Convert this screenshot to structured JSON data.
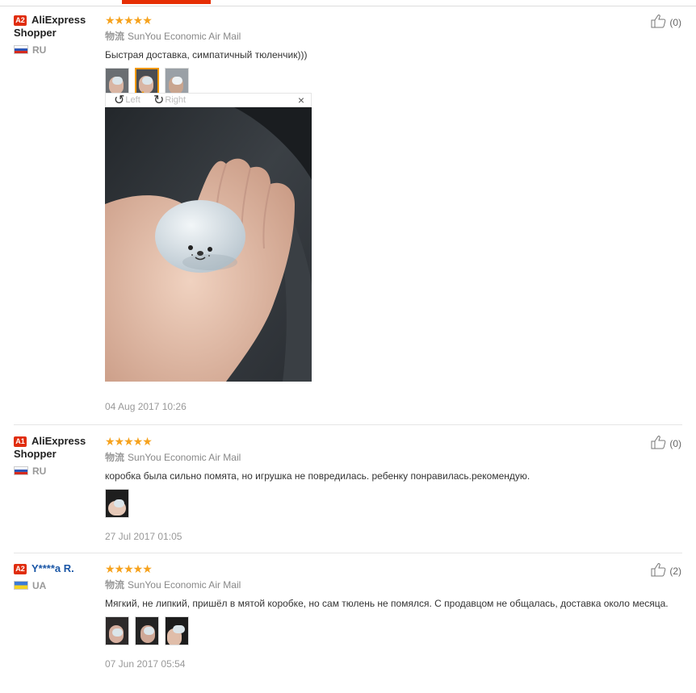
{
  "reviews": [
    {
      "badge": "A2",
      "name": "AliExpress Shopper",
      "country": "RU",
      "rating": 5,
      "stars_text": "★★★★★",
      "shipping_label": "物流",
      "shipping": "SunYou Economic Air Mail",
      "text": "Быстрая доставка, симпатичный тюленчик)))",
      "photos": 3,
      "date": "04 Aug 2017 10:26",
      "helpful": "(0)"
    },
    {
      "badge": "A1",
      "name": "AliExpress Shopper",
      "country": "RU",
      "rating": 5,
      "stars_text": "★★★★★",
      "shipping_label": "物流",
      "shipping": "SunYou Economic Air Mail",
      "text": "коробка была сильно помята, но игрушка не повредилась. ребенку понравилась.рекомендую.",
      "photos": 1,
      "date": "27 Jul 2017 01:05",
      "helpful": "(0)"
    },
    {
      "badge": "A2",
      "name": "Y****a R.",
      "country": "UA",
      "rating": 5,
      "stars_text": "★★★★★",
      "shipping_label": "物流",
      "shipping": "SunYou Economic Air Mail",
      "text": "Мягкий, не липкий, пришёл в мятой коробке, но сам тюлень не помялся. С продавцом не общалась, доставка около месяца.",
      "photos": 3,
      "date": "07 Jun 2017 05:54",
      "helpful": "(2)"
    }
  ],
  "viewer": {
    "rotate_left": "Left",
    "rotate_right": "Right",
    "close": "×"
  },
  "colors": {
    "accent": "#e62e04",
    "star": "#f6a21d",
    "badge": "#e02d0e"
  }
}
